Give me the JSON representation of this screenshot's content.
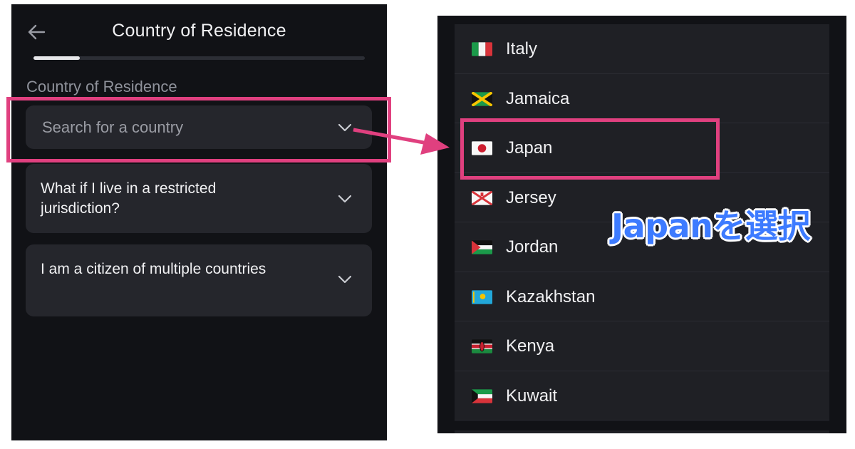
{
  "left": {
    "title": "Country of Residence",
    "progress": 0.14,
    "field_label": "Country of Residence",
    "search": {
      "placeholder": "Search for a country"
    },
    "faqs": [
      {
        "label": "What if I live in a restricted jurisdiction?"
      },
      {
        "label": "I am a citizen of multiple countries"
      }
    ]
  },
  "right": {
    "countries": [
      {
        "name": "Italy",
        "flag": "italy-flag-icon"
      },
      {
        "name": "Jamaica",
        "flag": "jamaica-flag-icon"
      },
      {
        "name": "Japan",
        "flag": "japan-flag-icon"
      },
      {
        "name": "Jersey",
        "flag": "jersey-flag-icon"
      },
      {
        "name": "Jordan",
        "flag": "jordan-flag-icon"
      },
      {
        "name": "Kazakhstan",
        "flag": "kazakhstan-flag-icon"
      },
      {
        "name": "Kenya",
        "flag": "kenya-flag-icon"
      },
      {
        "name": "Kuwait",
        "flag": "kuwait-flag-icon"
      }
    ]
  },
  "annotation": {
    "callout": "Japanを選択",
    "highlight_color": "#e0407f",
    "callout_color": "#3d7bff"
  }
}
